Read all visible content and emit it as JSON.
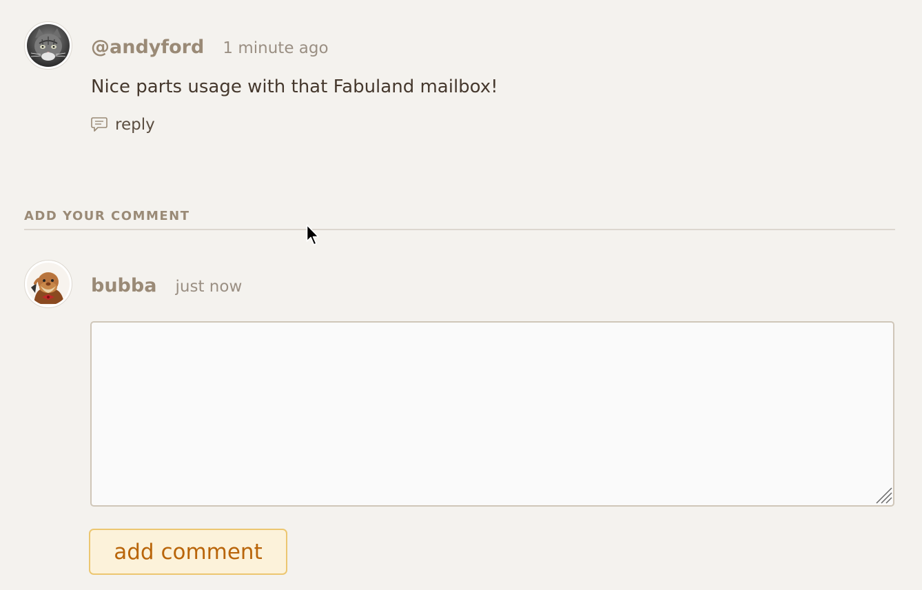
{
  "comment": {
    "username": "@andyford",
    "timestamp": "1 minute ago",
    "text": "Nice parts usage with that Fabuland mailbox!",
    "reply_label": "reply",
    "avatar_icon": "cat-avatar-icon"
  },
  "add_comment": {
    "heading": "ADD YOUR COMMENT",
    "username": "bubba",
    "timestamp": "just now",
    "textarea_value": "",
    "button_label": "add comment",
    "avatar_icon": "chef-avatar-icon"
  },
  "colors": {
    "background": "#f4f2ee",
    "username": "#9a8a76",
    "button_bg": "#fcf2da",
    "button_border": "#ecc670",
    "button_text": "#b9650a"
  }
}
